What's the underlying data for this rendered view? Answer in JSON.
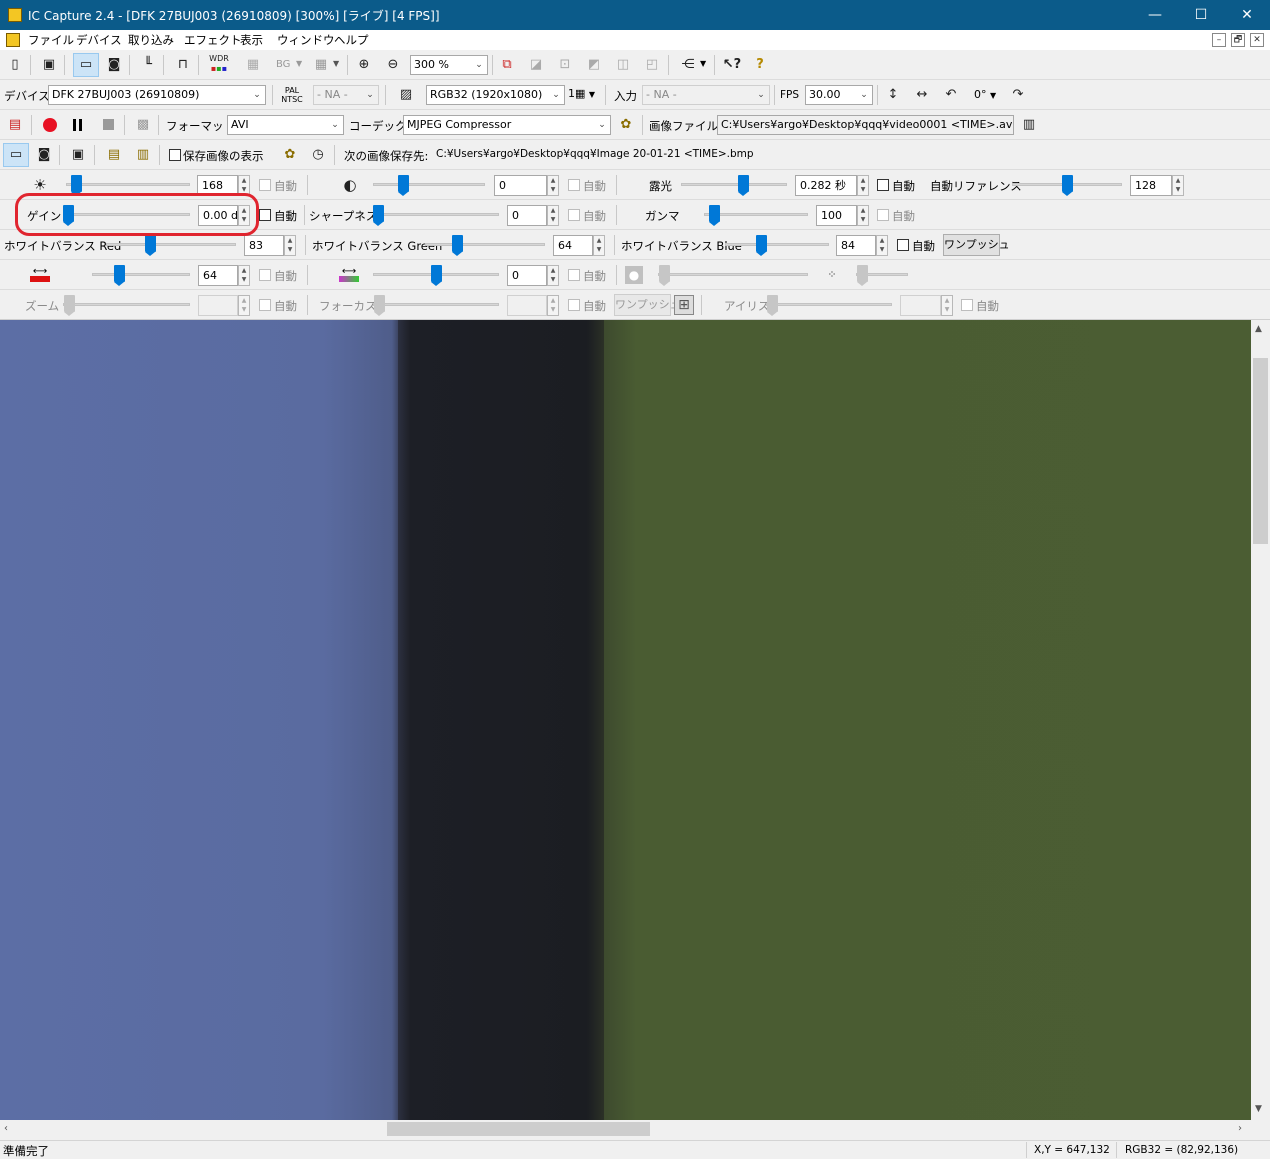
{
  "window": {
    "title": "IC Capture 2.4 - [DFK 27BUJ003 (26910809) [300%]  [ライブ]  [4 FPS]]",
    "minimize": "—",
    "maximize": "☐",
    "close": "✕"
  },
  "menu": {
    "items": [
      "ファイル",
      "デバイス",
      "取り込み",
      "エフェクト",
      "表示",
      "ウィンドウ",
      "ヘルプ"
    ],
    "mdi_buttons": [
      "–",
      "🗗",
      "✕"
    ]
  },
  "toolbar1": {
    "zoom_value": "300 %",
    "bg_label": "BG",
    "wdr_label": "WDR",
    "icons": [
      "new-icon",
      "save-icon",
      "live-camera-icon",
      "snapshot-icon",
      "histogram-icon",
      "trigger-icon",
      "wdr-icon",
      "grid-icon",
      "bg-icon",
      "layout-icon",
      "zoom-in-icon",
      "zoom-out-icon",
      "roi-icon",
      "overlay-icon",
      "help-context-icon",
      "help-icon"
    ]
  },
  "toolbar2": {
    "device_label": "デバイス",
    "device_value": "DFK 27BUJ003 (26910809)",
    "pal_ntsc": "PAL NTSC",
    "video_norm_value": "- NA -",
    "format_value": "RGB32 (1920x1080)",
    "buffer_value": "1▦",
    "input_label": "入力",
    "input_value": "- NA -",
    "fps_label": "FPS",
    "fps_value": "30.00",
    "rotation_value": "0°"
  },
  "toolbar3": {
    "format_label": "フォーマット",
    "format_value": "AVI",
    "codec_label": "コーデック",
    "codec_value": "MJPEG Compressor",
    "file_label": "画像ファイル",
    "file_value": "C:¥Users¥argo¥Desktop¥qqq¥video0001 <TIME>.avi"
  },
  "toolbar4": {
    "show_saved_label": "保存画像の表示",
    "next_save_label": "次の画像保存先:",
    "next_save_path": "C:¥Users¥argo¥Desktop¥qqq¥Image 20-01-21 <TIME>.bmp"
  },
  "properties": {
    "auto_label": "自動",
    "onepush_label": "ワンプッシュ",
    "brightness": {
      "value": "168",
      "level": 0.04
    },
    "contrast": {
      "value": "0",
      "level": 0.25
    },
    "exposure": {
      "label": "露光",
      "value": "0.282 秒",
      "level": 0.6
    },
    "auto_reference": {
      "label": "自動リファレンス",
      "value": "128",
      "level": 0.5
    },
    "gain": {
      "label": "ゲイン",
      "value": "0.00 d",
      "level": 0.0
    },
    "sharpness": {
      "label": "シャープネス",
      "value": "0",
      "level": 0.0
    },
    "gamma": {
      "label": "ガンマ",
      "value": "100",
      "level": 0.05
    },
    "wb_red": {
      "label": "ホワイトバランス Red",
      "value": "83",
      "level": 0.33
    },
    "wb_green": {
      "label": "ホワイトバランス Green",
      "value": "64",
      "level": 0.25
    },
    "wb_blue": {
      "label": "ホワイトバランス Blue",
      "value": "84",
      "level": 0.33
    },
    "hue": {
      "value": "64",
      "level": 0.25
    },
    "saturation": {
      "value": "0",
      "level": 0.5
    },
    "zoom": {
      "label": "ズーム"
    },
    "focus": {
      "label": "フォーカス"
    },
    "iris": {
      "label": "アイリス"
    }
  },
  "status": {
    "ready": "準備完了",
    "coords": "X,Y = 647,132",
    "pixel": "RGB32 = (82,92,136)"
  },
  "colors": {
    "titlebar": "#0b5b8a",
    "slider_thumb": "#0078d7",
    "highlight": "#e0252f",
    "video_left": "#5a6ba0",
    "video_mid": "#1d1f26",
    "video_right": "#4a5c32"
  }
}
